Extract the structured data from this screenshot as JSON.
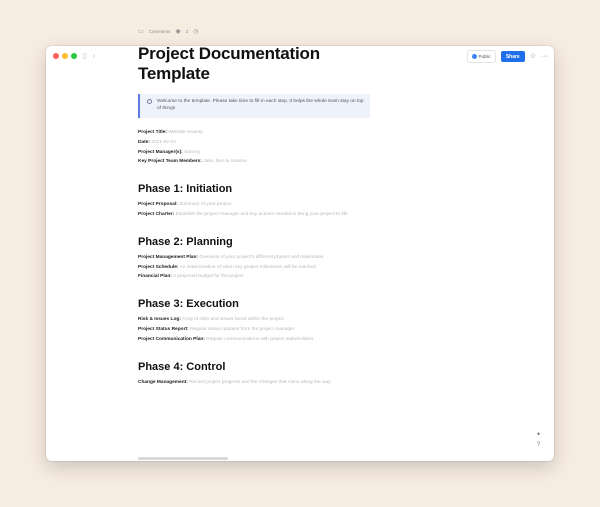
{
  "toolbar": {
    "public_label": "Public",
    "share_label": "Share"
  },
  "doc_toolbar": {
    "comments_label": "Comments",
    "viewers_count": "3"
  },
  "title": "Project Documentation Template",
  "callout": "Welcome to the template. Please take time to fill-in each step. It helps the whole team stay on top of things",
  "meta": [
    {
      "label": "Project Title:",
      "value": "Website revamp"
    },
    {
      "label": "Date:",
      "value": "2021-02-22"
    },
    {
      "label": "Project Manager(s):",
      "value": "Sammy"
    },
    {
      "label": "Key Project Team Members:",
      "value": "Jake, Ben & Arianna"
    }
  ],
  "phases": [
    {
      "heading": "Phase 1: Initiation",
      "items": [
        {
          "label": "Project Proposal:",
          "value": "Summary of your project"
        },
        {
          "label": "Project Charter:",
          "value": "Establish the project manager and key actions needed to bring your project to life"
        }
      ]
    },
    {
      "heading": "Phase 2: Planning",
      "items": [
        {
          "label": "Project Management Plan:",
          "value": "Overview of your project's different phases and milestones"
        },
        {
          "label": "Project Schedule:",
          "value": "An initial timeline of when key project milestones will be reached"
        },
        {
          "label": "Financial Plan:",
          "value": "A projected budget for the project"
        }
      ]
    },
    {
      "heading": "Phase 3: Execution",
      "items": [
        {
          "label": "Risk & Issues Log:",
          "value": "A log of risks and issues faced within the project"
        },
        {
          "label": "Project Status Report:",
          "value": "Regular status updates from the project manager"
        },
        {
          "label": "Project Communication Plan:",
          "value": "Regular communications with project stakeholders"
        }
      ]
    },
    {
      "heading": "Phase 4: Control",
      "items": [
        {
          "label": "Change Management:",
          "value": "Record project progress and the changes that came along the way"
        }
      ]
    }
  ],
  "icons": {
    "sidebar": "sidebar-toggle-icon",
    "back": "chevron-left-icon",
    "star": "star-icon",
    "more": "more-icon",
    "comments": "comment-icon",
    "viewers": "eye-icon",
    "history": "clock-icon",
    "help": "help-icon",
    "ai": "sparkle-icon"
  },
  "colors": {
    "share": "#1f6feb",
    "callout_bg": "#eef2fb",
    "callout_border": "#5a7be0",
    "backdrop": "#f7ece2"
  }
}
